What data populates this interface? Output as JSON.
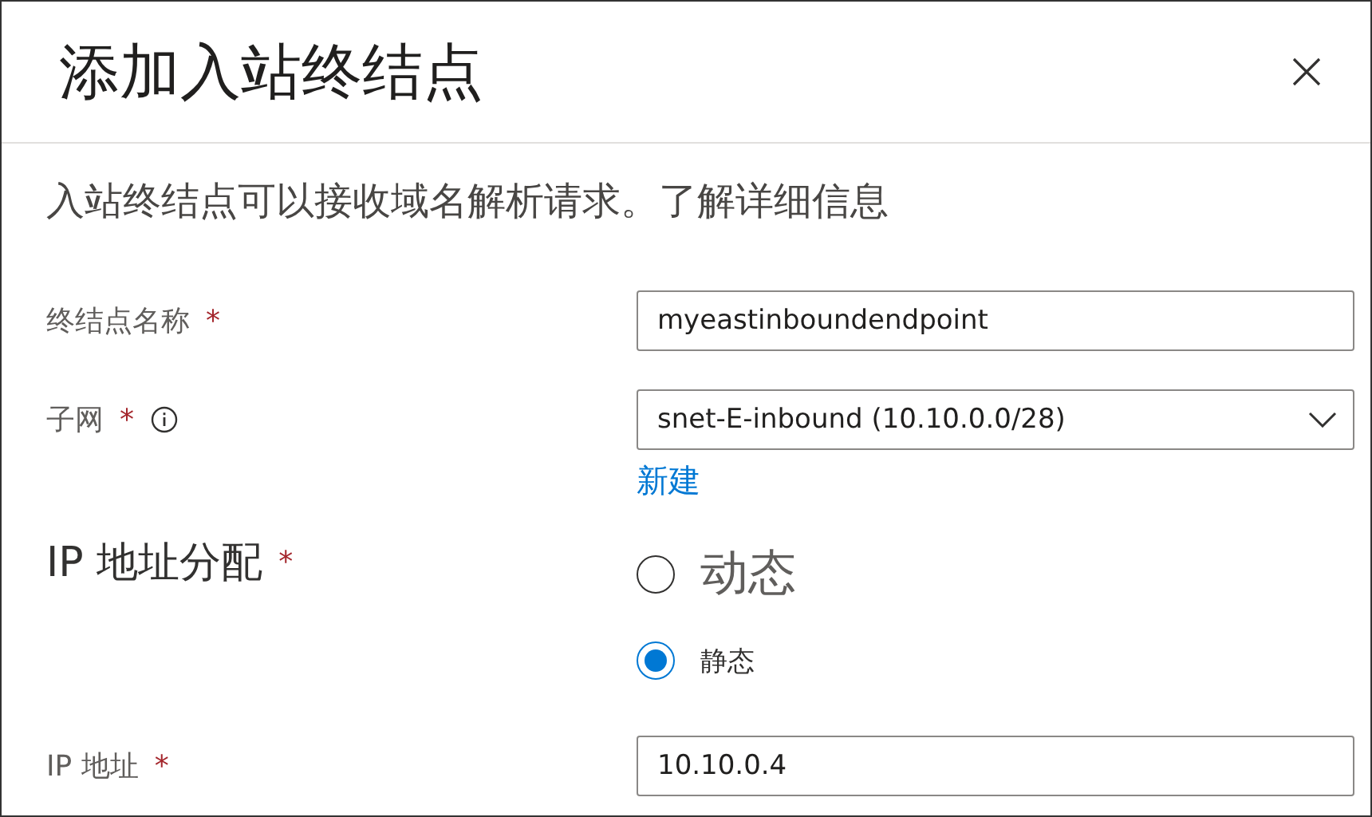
{
  "title": "添加入站终结点",
  "description": "入站终结点可以接收域名解析请求。了解详细信息",
  "fields": [
    {
      "kind": "text",
      "label": "终结点名称",
      "mark": "*",
      "value": "myeastinboundendpoint"
    },
    {
      "kind": "select",
      "label": "子网",
      "mark": "*",
      "info": true,
      "value": "snet-E-inbound (10.10.0.0/28)",
      "link": "新建"
    },
    {
      "kind": "radio",
      "label": "IP 地址分配",
      "mark": "*",
      "options": [
        {
          "label": "动态",
          "selected": false
        },
        {
          "label": "静态",
          "selected": true
        }
      ]
    },
    {
      "kind": "text",
      "label": "IP 地址",
      "mark": "*",
      "value": "10.10.0.4"
    }
  ]
}
